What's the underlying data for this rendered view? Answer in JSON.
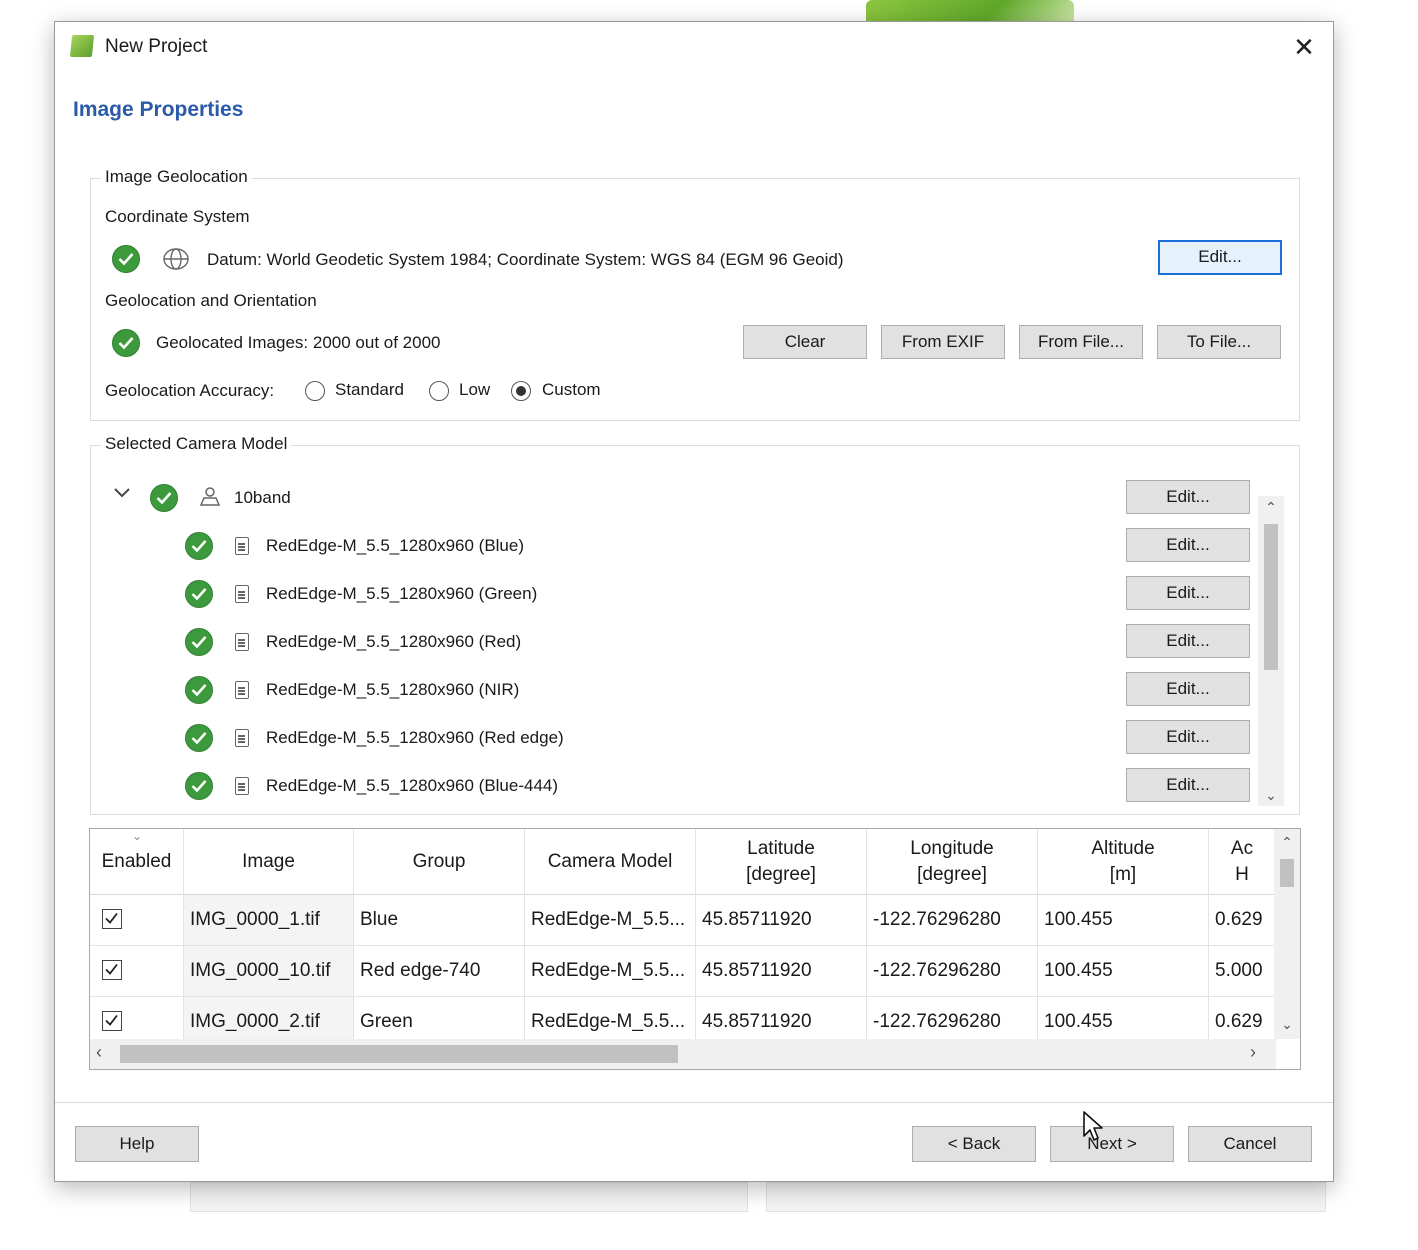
{
  "window": {
    "title": "New Project",
    "close_symbol": "✕"
  },
  "page": {
    "heading": "Image Properties"
  },
  "geolocation": {
    "group_title": "Image Geolocation",
    "coordinate_system_label": "Coordinate System",
    "coordinate_system_text": "Datum: World Geodetic System 1984; Coordinate System: WGS 84 (EGM 96 Geoid)",
    "edit_label": "Edit...",
    "geo_orientation_label": "Geolocation and Orientation",
    "geolocated_text": "Geolocated Images: 2000 out of 2000",
    "buttons": {
      "clear": "Clear",
      "from_exif": "From EXIF",
      "from_file": "From File...",
      "to_file": "To File..."
    },
    "accuracy_label": "Geolocation Accuracy:",
    "accuracy_options": [
      "Standard",
      "Low",
      "Custom"
    ],
    "accuracy_selected": "Custom"
  },
  "camera": {
    "group_title": "Selected Camera Model",
    "root_label": "10band",
    "edit_label": "Edit...",
    "items": [
      "RedEdge-M_5.5_1280x960 (Blue)",
      "RedEdge-M_5.5_1280x960 (Green)",
      "RedEdge-M_5.5_1280x960 (Red)",
      "RedEdge-M_5.5_1280x960 (NIR)",
      "RedEdge-M_5.5_1280x960 (Red edge)",
      "RedEdge-M_5.5_1280x960 (Blue-444)"
    ]
  },
  "table": {
    "columns": [
      "Enabled",
      "Image",
      "Group",
      "Camera Model",
      "Latitude\n[degree]",
      "Longitude\n[degree]",
      "Altitude\n[m]",
      "Ac\nH"
    ],
    "rows": [
      {
        "enabled": true,
        "image": "IMG_0000_1.tif",
        "group": "Blue",
        "camera": "RedEdge-M_5.5...",
        "lat": "45.85711920",
        "lon": "-122.76296280",
        "alt": "100.455",
        "acc": "0.629"
      },
      {
        "enabled": true,
        "image": "IMG_0000_10.tif",
        "group": "Red edge-740",
        "camera": "RedEdge-M_5.5...",
        "lat": "45.85711920",
        "lon": "-122.76296280",
        "alt": "100.455",
        "acc": "5.000"
      },
      {
        "enabled": true,
        "image": "IMG_0000_2.tif",
        "group": "Green",
        "camera": "RedEdge-M_5.5...",
        "lat": "45.85711920",
        "lon": "-122.76296280",
        "alt": "100.455",
        "acc": "0.629"
      }
    ]
  },
  "footer": {
    "help": "Help",
    "back": "< Back",
    "next": "Next >",
    "cancel": "Cancel"
  },
  "colors": {
    "heading": "#2a5aa8",
    "ok_green": "#3c9a3c",
    "focus_blue": "#1e6fd9"
  }
}
